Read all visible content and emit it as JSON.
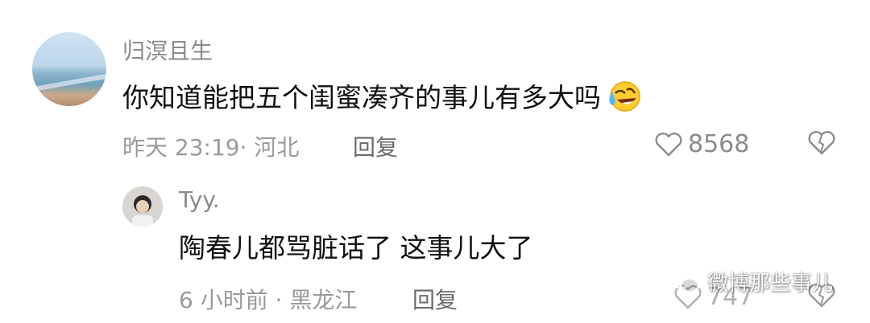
{
  "comment": {
    "username": "归溟且生",
    "text": "你知道能把五个闺蜜凑齐的事儿有多大吗",
    "emoji_icon": "rolling-laughing-emoji",
    "meta": "昨天 23:19· 河北",
    "reply_label": "回复",
    "like_count": "8568"
  },
  "reply": {
    "username": "Tyy.",
    "text": "陶春儿都骂脏话了 这事儿大了",
    "meta": "6 小时前 · 黑龙江",
    "reply_label": "回复",
    "like_count": "747"
  },
  "watermark": {
    "text": "微博那些事儿"
  }
}
